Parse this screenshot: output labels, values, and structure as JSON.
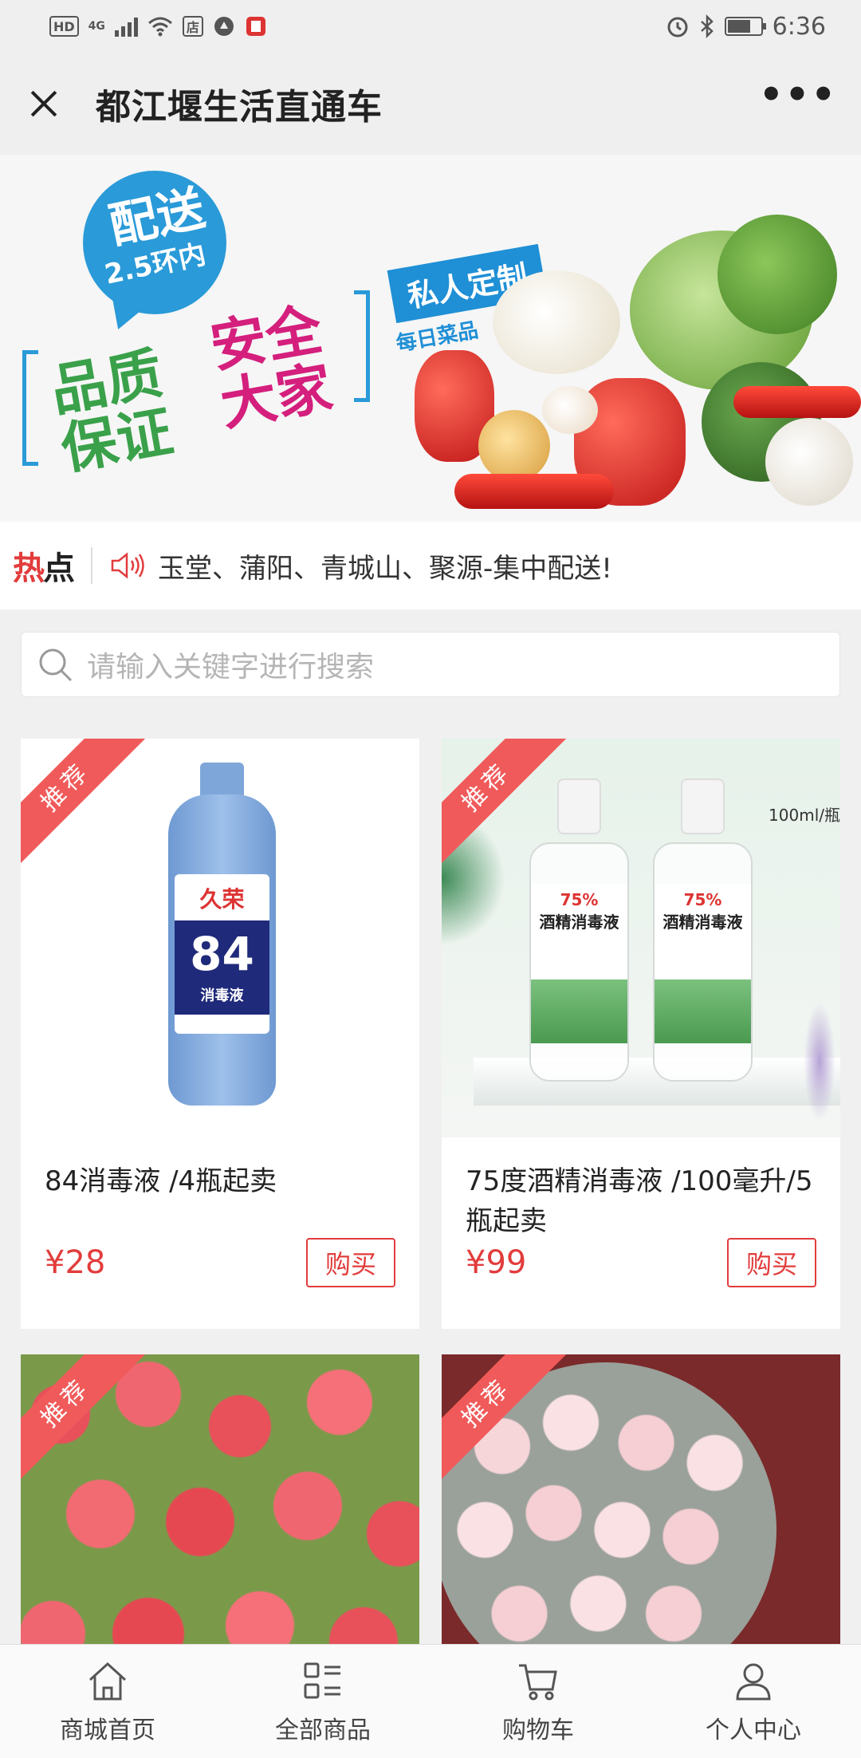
{
  "status_bar": {
    "left_chips": [
      "HD",
      "4G",
      "店"
    ],
    "time": "6:36",
    "battery_level_percent": 70
  },
  "title_bar": {
    "title": "都江堰生活直通车",
    "close_icon": "close-icon",
    "more_label": "•••"
  },
  "banner": {
    "bubble_line1": "配送",
    "bubble_line2": "2.5环内",
    "slogan_green": "品质保证",
    "slogan_pink": "安全大家",
    "custom_tag": "私人定制",
    "daily_tag": "每日菜品"
  },
  "hot": {
    "label_red": "热",
    "label_dark": "点",
    "text": "玉堂、蒲阳、青城山、聚源-集中配送!"
  },
  "search": {
    "placeholder": "请输入关键字进行搜索"
  },
  "products": [
    {
      "ribbon": "推荐",
      "name": "84消毒液 /4瓶起卖",
      "price": "¥28",
      "buy_label": "购买"
    },
    {
      "ribbon": "推荐",
      "name": "75度酒精消毒液 /100毫升/5瓶起卖",
      "price": "¥99",
      "buy_label": "购买",
      "image_caption": "100ml/瓶"
    },
    {
      "ribbon": "推荐"
    },
    {
      "ribbon": "推荐"
    }
  ],
  "product_images": {
    "bleach_brand": "久荣",
    "bleach_number": "84",
    "bleach_label": "消毒液",
    "alcohol_percent": "75%",
    "alcohol_label": "酒精消毒液"
  },
  "tabbar": [
    {
      "label": "商城首页",
      "icon": "home-icon"
    },
    {
      "label": "全部商品",
      "icon": "list-icon"
    },
    {
      "label": "购物车",
      "icon": "cart-icon"
    },
    {
      "label": "个人中心",
      "icon": "user-icon"
    }
  ],
  "colors": {
    "accent_red": "#e23c3c",
    "ribbon_red": "#f05a5a",
    "banner_blue": "#2a9ad8",
    "banner_green": "#3aa14a",
    "banner_pink": "#d41f7d"
  }
}
